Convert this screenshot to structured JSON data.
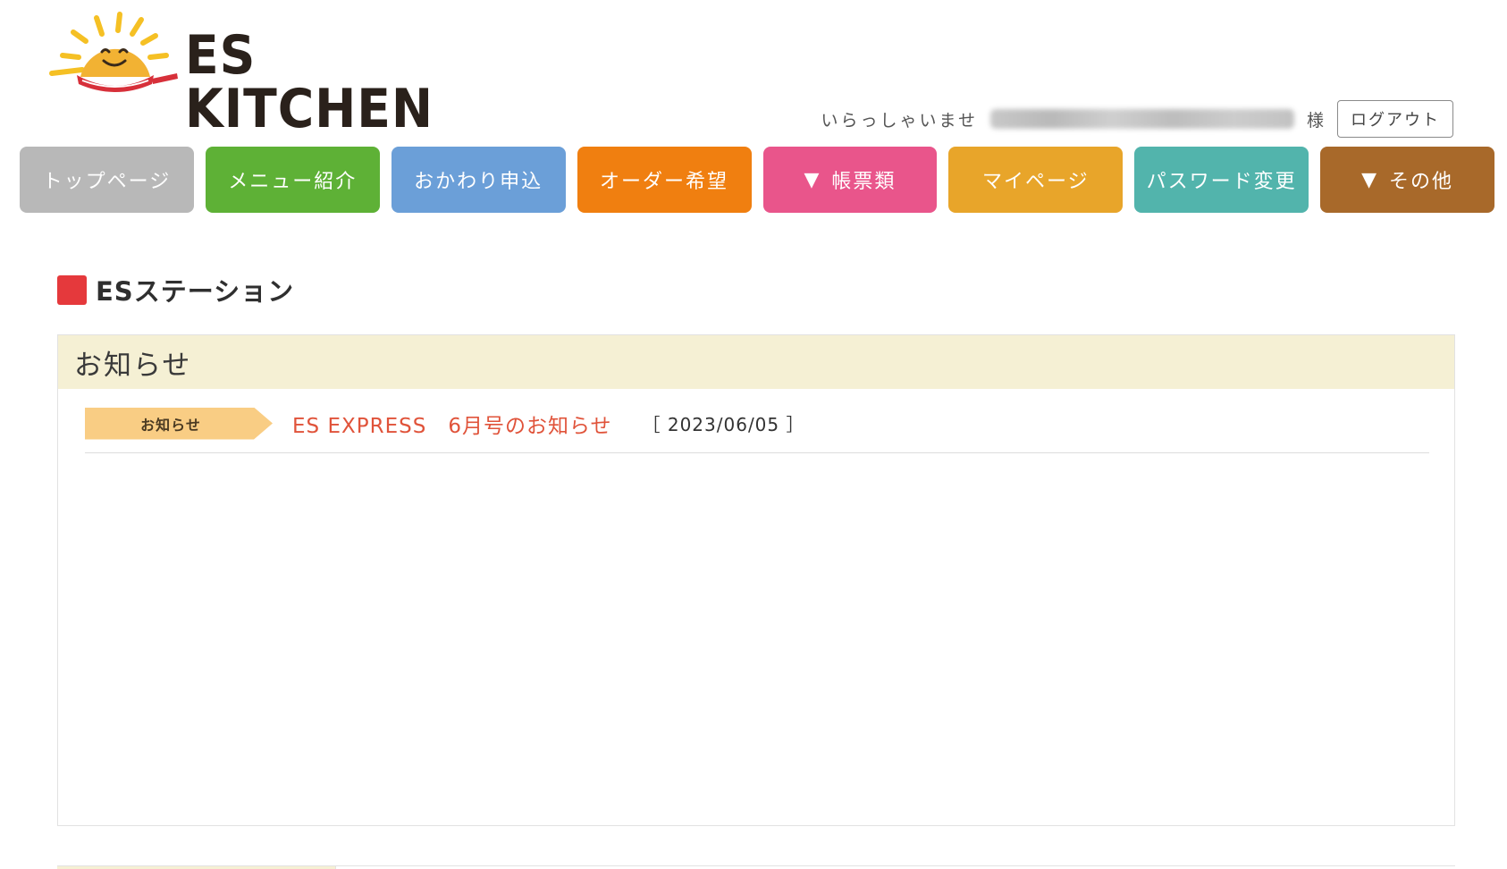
{
  "brand": {
    "logo_text": "ES KITCHEN",
    "sun_color": "#f2b233",
    "pan_color": "#d7303a"
  },
  "welcome": {
    "greeting": "いらっしゃいませ",
    "suffix": "様",
    "logout_label": "ログアウト"
  },
  "nav": [
    {
      "label": "トップページ",
      "color": "#b8b8b8",
      "dropdown": false
    },
    {
      "label": "メニュー紹介",
      "color": "#5eb136",
      "dropdown": false
    },
    {
      "label": "おかわり申込",
      "color": "#6b9fd8",
      "dropdown": false
    },
    {
      "label": "オーダー希望",
      "color": "#f07f10",
      "dropdown": false
    },
    {
      "label": "帳票類",
      "color": "#e9558b",
      "dropdown": true
    },
    {
      "label": "マイページ",
      "color": "#e8a52a",
      "dropdown": false
    },
    {
      "label": "パスワード変更",
      "color": "#52b4ac",
      "dropdown": false
    },
    {
      "label": "その他",
      "color": "#a8692a",
      "dropdown": true
    }
  ],
  "dropdown_marker": "▼",
  "section": {
    "title": "ESステーション",
    "marker_color": "#e5393c"
  },
  "notices_panel": {
    "heading": "お知らせ",
    "items": [
      {
        "tag": "お知らせ",
        "title": "ES EXPRESS　6月号のお知らせ",
        "date": "［ 2023/06/05 ］"
      }
    ]
  }
}
